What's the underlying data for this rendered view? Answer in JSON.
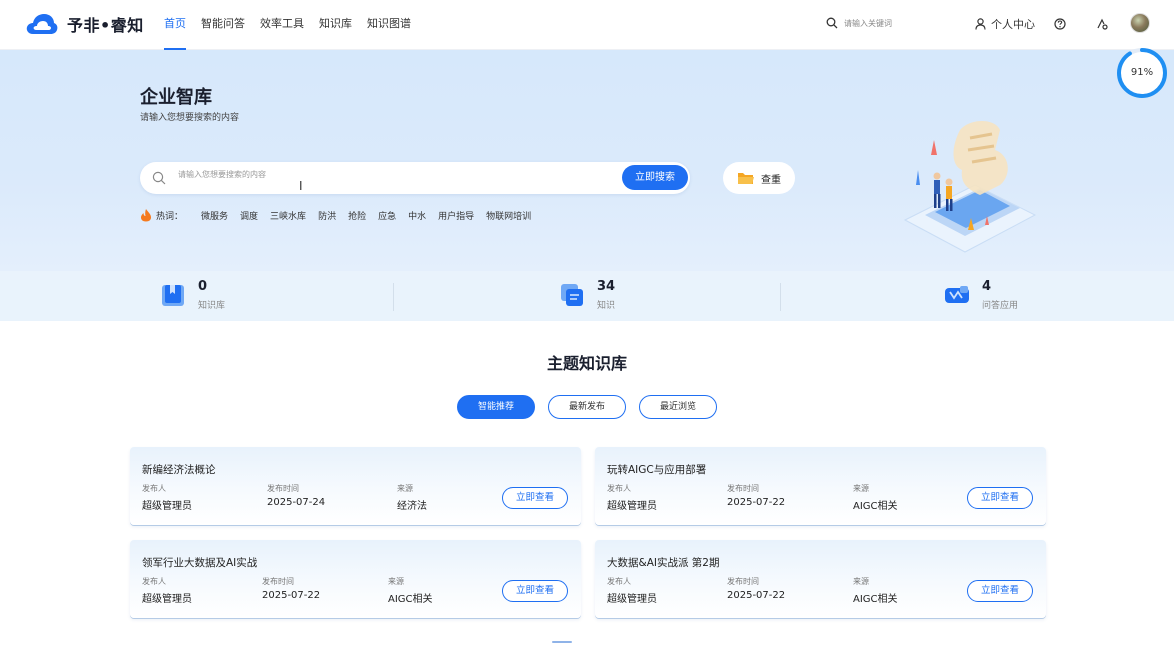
{
  "brand": {
    "name": "予非•睿知"
  },
  "nav": [
    {
      "label": "首页"
    },
    {
      "label": "智能问答"
    },
    {
      "label": "效率工具"
    },
    {
      "label": "知识库"
    },
    {
      "label": "知识图谱"
    }
  ],
  "top_search": {
    "placeholder": "请输入关键词"
  },
  "user": {
    "center_label": "个人中心"
  },
  "progress": {
    "percent": 91,
    "text": "91%"
  },
  "hero": {
    "title": "企业智库",
    "subtitle": "请输入您想要搜索的内容",
    "search_placeholder": "请输入您想要搜索的内容",
    "search_button": "立即搜索",
    "dedup_button": "查重",
    "hot_label": "热词：",
    "hot_words": [
      "微服务",
      "调度",
      "三峡水库",
      "防洪",
      "抢险",
      "应急",
      "中水",
      "用户指导",
      "物联网培训"
    ]
  },
  "stats": [
    {
      "value": "0",
      "label": "知识库"
    },
    {
      "value": "34",
      "label": "知识"
    },
    {
      "value": "4",
      "label": "问答应用"
    }
  ],
  "section": {
    "title": "主题知识库",
    "tabs": [
      "智能推荐",
      "最新发布",
      "最近浏览"
    ]
  },
  "meta_labels": {
    "publisher": "发布人",
    "time": "发布时间",
    "source": "来源"
  },
  "cards": [
    {
      "title": "新编经济法概论",
      "publisher": "超级管理员",
      "time": "2025-07-24",
      "source": "经济法",
      "button": "立即查看"
    },
    {
      "title": "玩转AIGC与应用部署",
      "publisher": "超级管理员",
      "time": "2025-07-22",
      "source": "AIGC相关",
      "button": "立即查看"
    },
    {
      "title": "领军行业大数据及AI实战",
      "publisher": "超级管理员",
      "time": "2025-07-22",
      "source": "AIGC相关",
      "button": "立即查看"
    },
    {
      "title": "大数据&AI实战派 第2期",
      "publisher": "超级管理员",
      "time": "2025-07-22",
      "source": "AIGC相关",
      "button": "立即查看"
    }
  ],
  "colors": {
    "accent": "#1f6ff2",
    "hero_bg": "#d6e8fb",
    "stats_bg": "#e9f3fc"
  }
}
